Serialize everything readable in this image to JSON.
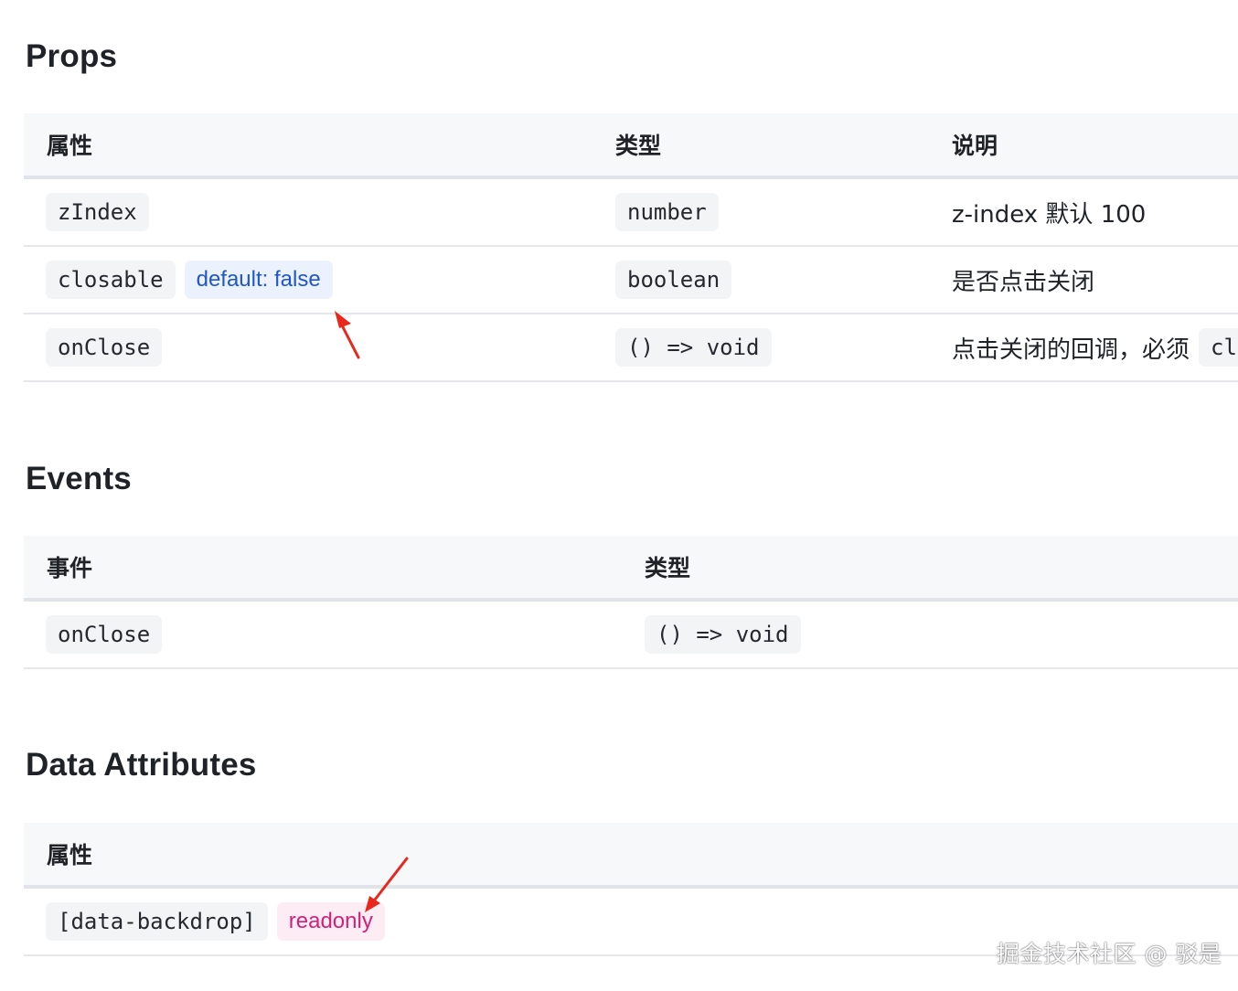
{
  "sections": {
    "props": {
      "title": "Props",
      "headers": {
        "attr": "属性",
        "type": "类型",
        "desc": "说明"
      },
      "rows": [
        {
          "name": "zIndex",
          "type": "number",
          "desc": "z-index 默认 100"
        },
        {
          "name": "closable",
          "badge": "default: false",
          "type": "boolean",
          "desc": "是否点击关闭"
        },
        {
          "name": "onClose",
          "type": "() => void",
          "desc": "点击关闭的回调，必须",
          "desc_code": "cl"
        }
      ]
    },
    "events": {
      "title": "Events",
      "headers": {
        "event": "事件",
        "type": "类型"
      },
      "rows": [
        {
          "name": "onClose",
          "type": "() => void"
        }
      ]
    },
    "data_attributes": {
      "title": "Data Attributes",
      "headers": {
        "attr": "属性"
      },
      "rows": [
        {
          "name": "[data-backdrop]",
          "badge": "readonly"
        }
      ]
    }
  },
  "watermark": "掘金技术社区 @ 驳是",
  "colors": {
    "header_bg": "#f6f8fa",
    "code_bg": "#f3f4f6",
    "default_badge": "#2156c8",
    "readonly_badge": "#cf2278",
    "arrow": "#e8271d"
  }
}
